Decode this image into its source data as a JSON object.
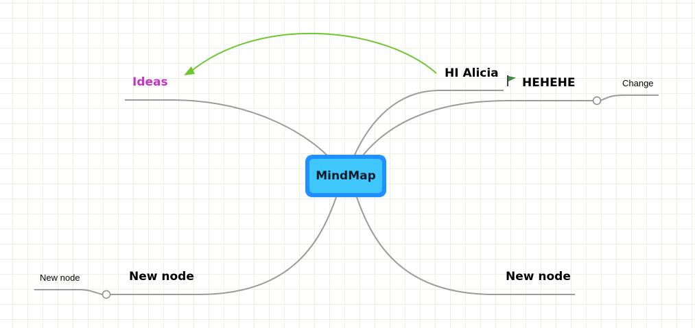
{
  "root": {
    "label": "MindMap"
  },
  "nodes": {
    "ideas": {
      "label": "Ideas",
      "color": "#c733c9"
    },
    "hi_alicia": {
      "label": "HI Alicia"
    },
    "hehehe": {
      "label": "HEHEHE",
      "icon": "green-flag-icon"
    },
    "change": {
      "label": "Change"
    },
    "new_node_left": {
      "label": "New node"
    },
    "new_node_left_child": {
      "label": "New node"
    },
    "new_node_right": {
      "label": "New node"
    }
  },
  "colors": {
    "connector": "#9a9a9a",
    "relationship_arrow": "#6cc72f",
    "root_border": "#1f90ff",
    "root_fill": "#3fc6fb",
    "flag": "#3a8f47"
  }
}
